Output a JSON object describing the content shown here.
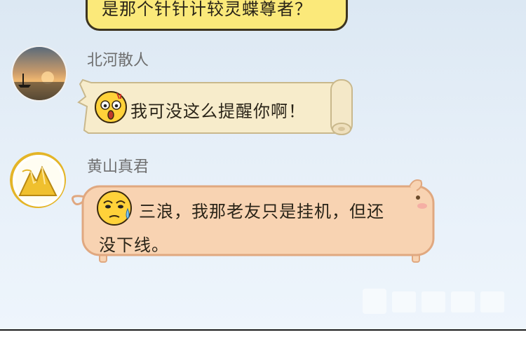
{
  "messages": [
    {
      "bubble_style": "yellow",
      "text": "是那个针针计较灵蝶尊者？"
    },
    {
      "sender": "北河散人",
      "avatar_icon": "sunset-boat-avatar",
      "bubble_style": "scroll",
      "emoji_icon": "shocked-face-emoji",
      "text": "我可没这么提醒你啊！"
    },
    {
      "sender": "黄山真君",
      "avatar_icon": "mountain-avatar",
      "bubble_style": "pig",
      "emoji_icon": "sweating-face-emoji",
      "text_line1": "三浪，我那老友只是挂机，但还",
      "text_line2": "没下线。"
    }
  ],
  "colors": {
    "background_top": "#dce8f3",
    "background_bottom": "#eef5fc",
    "yellow_bubble": "#fbe97a",
    "scroll_bubble": "#f7eccb",
    "pig_bubble": "#f8d3b2",
    "pig_border": "#e0a880",
    "name_text": "#6e6e6e"
  }
}
